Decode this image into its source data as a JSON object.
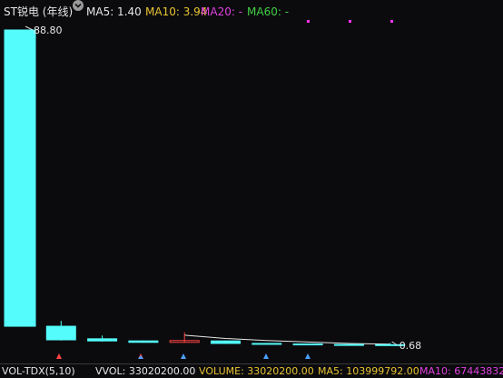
{
  "header": {
    "title": "ST锐电 (年线)",
    "ma5": "MA5: 1.40",
    "ma10": "MA10: 3.94",
    "ma20": "MA20: -",
    "ma60": "MA60: -",
    "icon": "chevron-down-icon"
  },
  "chart_data": {
    "type": "candlestick",
    "period": "yearly",
    "candles": [
      {
        "open": 88.8,
        "close": 6.0,
        "high": 88.8,
        "low": 6.0
      },
      {
        "open": 6.0,
        "close": 2.2,
        "high": 7.5,
        "low": 2.0
      },
      {
        "open": 2.5,
        "close": 1.9,
        "high": 3.4,
        "low": 1.7
      },
      {
        "open": 1.9,
        "close": 1.5,
        "high": 2.0,
        "low": 1.4
      },
      {
        "open": 1.5,
        "close": 2.0,
        "high": 4.3,
        "low": 1.4
      },
      {
        "open": 1.9,
        "close": 1.2,
        "high": 2.0,
        "low": 1.1
      },
      {
        "open": 1.2,
        "close": 1.1,
        "high": 1.25,
        "low": 0.9
      },
      {
        "open": 1.05,
        "close": 0.8,
        "high": 1.1,
        "low": 0.7
      },
      {
        "open": 0.9,
        "close": 0.75,
        "high": 0.95,
        "low": 0.68
      },
      {
        "open": 0.85,
        "close": 0.72,
        "high": 1.3,
        "low": 0.68
      }
    ],
    "ma5_line": [
      null,
      null,
      null,
      null,
      3.5,
      2.6,
      2.0,
      1.6,
      1.2,
      1.0
    ],
    "max_label": "88.80",
    "min_label": "0.68",
    "colors": {
      "down": "#54fcfc",
      "up": "#ff4444",
      "ma5": "#e6e6e6",
      "ma20": "#ff33ff",
      "ma10": "#e8c330"
    }
  },
  "volume_bar": {
    "indicator": "VOL-TDX(5,10)",
    "vvol": "VVOL: 33020200.00",
    "volume": "VOLUME: 33020200.00",
    "ma5": "MA5: 103999792.00",
    "ma10": "MA10: 67443832"
  }
}
